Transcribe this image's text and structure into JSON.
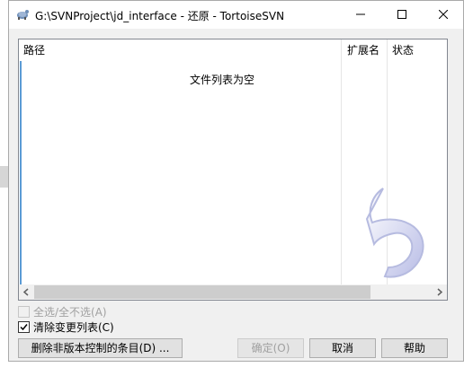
{
  "window": {
    "title": "G:\\SVNProject\\jd_interface - 还原 - TortoiseSVN"
  },
  "titlebar_buttons": [
    "minimize-icon",
    "maximize-icon",
    "close-icon"
  ],
  "file_list": {
    "columns": [
      "路径",
      "扩展名",
      "状态"
    ],
    "empty_message": "文件列表为空"
  },
  "options": {
    "select_all_label": "全选/全不选(A)",
    "select_all_checked": false,
    "select_all_enabled": false,
    "clear_changelist_label": "清除变更列表(C)",
    "clear_changelist_checked": true
  },
  "buttons": {
    "delete_unversioned": "删除非版本控制的条目(D) ...",
    "ok": "确定(O)",
    "cancel": "取消",
    "help": "帮助"
  },
  "colors": {
    "accent": "#5b9bd5",
    "window_bg": "#f0f0f0",
    "disabled_text": "#a0a0a0"
  }
}
